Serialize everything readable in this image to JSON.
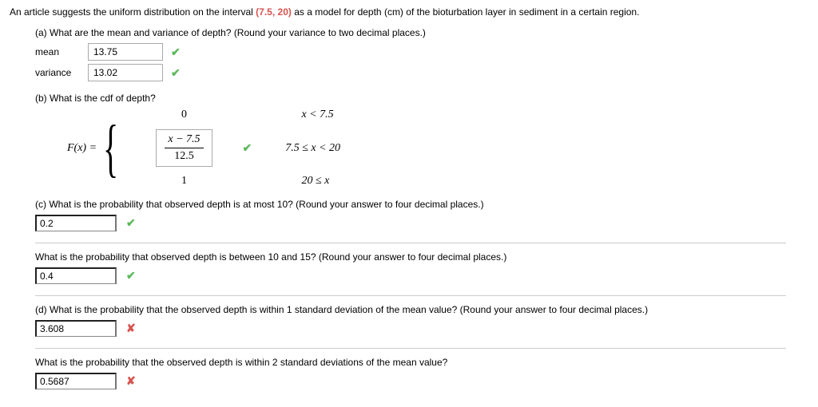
{
  "intro": {
    "pre": "An article suggests the uniform distribution on the interval ",
    "interval_open": "(7.5",
    "interval_comma": ", ",
    "interval_close": "20)",
    "post": " as a model for depth (cm) of the bioturbation layer in sediment in a certain region."
  },
  "part_a": {
    "question": "(a) What are the mean and variance of depth? (Round your variance to two decimal places.)",
    "mean_label": "mean",
    "mean_value": "13.75",
    "variance_label": "variance",
    "variance_value": "13.02"
  },
  "part_b": {
    "question": "(b) What is the cdf of depth?",
    "fx_label": "F(x) = ",
    "row0_val": "0",
    "row0_cond": "x < 7.5",
    "row1_num": "x − 7.5",
    "row1_den": "12.5",
    "row1_cond": "7.5 ≤ x < 20",
    "row2_val": "1",
    "row2_cond": "20 ≤ x"
  },
  "part_c": {
    "question": "(c) What is the probability that observed depth is at most 10? (Round your answer to four decimal places.)",
    "answer": "0.2"
  },
  "part_c2": {
    "question": "What is the probability that observed depth is between 10 and 15? (Round your answer to four decimal places.)",
    "answer": "0.4"
  },
  "part_d": {
    "question": "(d) What is the probability that the observed depth is within 1 standard deviation of the mean value? (Round your answer to four decimal places.)",
    "answer": "3.608"
  },
  "part_d2": {
    "question": "What is the probability that the observed depth is within 2 standard deviations of the mean value?",
    "answer": "0.5687"
  },
  "icons": {
    "check": "✔",
    "cross": "✘"
  }
}
